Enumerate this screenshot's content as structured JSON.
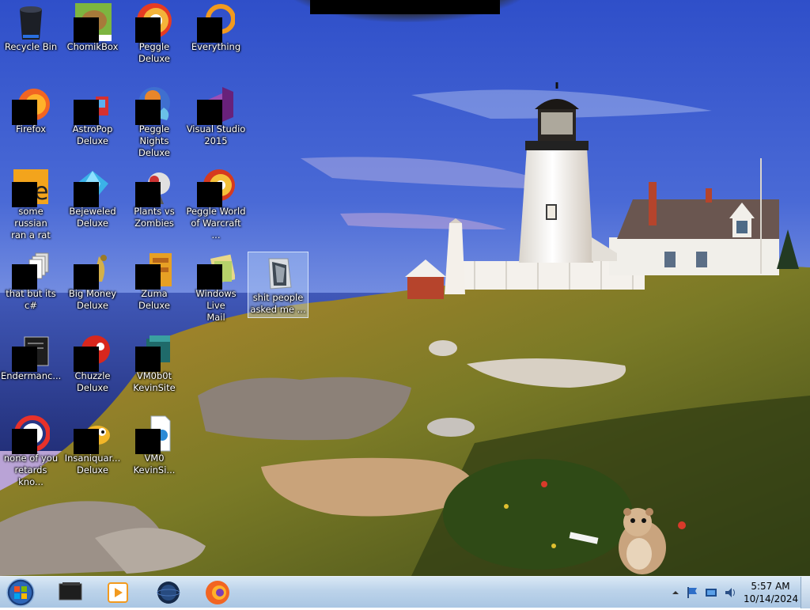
{
  "desktop": {
    "icons": [
      {
        "label": "Recycle Bin",
        "icon": "recycle-bin-icon"
      },
      {
        "label": "ChomikBox",
        "icon": "chomikbox-icon"
      },
      {
        "label": "Peggle Deluxe",
        "icon": "peggle-deluxe-icon"
      },
      {
        "label": "Everything",
        "icon": "everything-icon"
      },
      {
        "label": "Firefox",
        "icon": "firefox-icon"
      },
      {
        "label": "AstroPop\nDeluxe",
        "icon": "astropop-icon"
      },
      {
        "label": "Peggle Nights\nDeluxe",
        "icon": "peggle-nights-icon"
      },
      {
        "label": "Visual Studio\n2015",
        "icon": "visual-studio-icon"
      },
      {
        "label": "some russian\nran a rat",
        "icon": "scratch-e-icon"
      },
      {
        "label": "Bejeweled\nDeluxe",
        "icon": "bejeweled-icon"
      },
      {
        "label": "Plants vs\nZombies",
        "icon": "plants-vs-zombies-icon"
      },
      {
        "label": "Peggle World\nof Warcraft ...",
        "icon": "peggle-wow-icon"
      },
      {
        "label": "that but its c#",
        "icon": "stacked-files-icon"
      },
      {
        "label": "Big Money\nDeluxe",
        "icon": "big-money-icon"
      },
      {
        "label": "Zuma Deluxe",
        "icon": "zuma-icon"
      },
      {
        "label": "Windows Live\nMail",
        "icon": "windows-live-mail-icon"
      },
      {
        "label": "shit people\nasked me ...",
        "icon": "folder-icon"
      },
      {
        "label": "Endermanc...",
        "icon": "terminal-icon"
      },
      {
        "label": "Chuzzle\nDeluxe",
        "icon": "chuzzle-icon"
      },
      {
        "label": "VM0b0t\nKevinSite",
        "icon": "vm-folder-icon"
      },
      {
        "label": "none of you\nretards kno...",
        "icon": "opera-icon"
      },
      {
        "label": "Insaniquar...\nDeluxe",
        "icon": "insaniquarium-icon"
      },
      {
        "label": "VM0\nKevinSi...",
        "icon": "document-icon"
      }
    ]
  },
  "taskbar": {
    "pinned": [
      {
        "name": "start-orb",
        "icon": "windows-start-icon"
      },
      {
        "name": "taskbar-app-1",
        "icon": "dark-box-icon"
      },
      {
        "name": "taskbar-app-2",
        "icon": "media-player-icon"
      },
      {
        "name": "taskbar-app-3",
        "icon": "globe-icon"
      },
      {
        "name": "taskbar-firefox",
        "icon": "firefox-icon"
      }
    ],
    "clock": {
      "time": "5:57 AM",
      "date": "10/14/2024"
    }
  },
  "colors": {
    "taskbar": "#bcd3ea",
    "sky": "#3f5fcf",
    "label_text": "#ffffff"
  }
}
